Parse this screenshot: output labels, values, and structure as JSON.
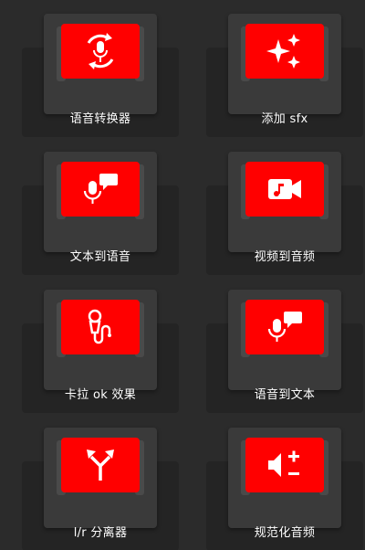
{
  "tiles": [
    {
      "label": "语音转换器",
      "icon": "voice-changer-icon"
    },
    {
      "label": "添加 sfx",
      "icon": "sparkles-icon"
    },
    {
      "label": "文本到语音",
      "icon": "text-to-speech-icon"
    },
    {
      "label": "视频到音频",
      "icon": "video-to-audio-icon"
    },
    {
      "label": "卡拉 ok 效果",
      "icon": "karaoke-mic-icon"
    },
    {
      "label": "语音到文本",
      "icon": "speech-to-text-icon"
    },
    {
      "label": "l/r 分离器",
      "icon": "split-arrows-icon"
    },
    {
      "label": "规范化音频",
      "icon": "normalize-volume-icon"
    }
  ],
  "colors": {
    "background": "#2b2b2b",
    "accent": "#ff0000",
    "text": "#ffffff"
  }
}
